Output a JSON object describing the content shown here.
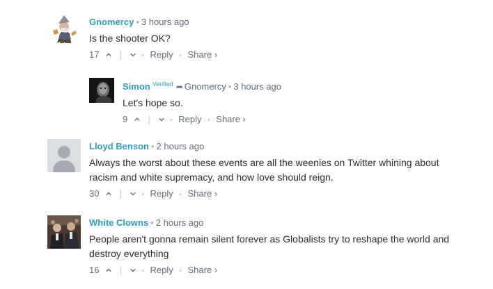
{
  "comments": [
    {
      "author": "Gnomercy",
      "sep": "•",
      "time": "3 hours ago",
      "text": "Is the shooter OK?",
      "votes": "17",
      "reply": "Reply",
      "share": "Share ›"
    },
    {
      "author": "Simon",
      "verified": "Verified",
      "parent": "Gnomercy",
      "sep": "•",
      "time": "3 hours ago",
      "text": "Let's hope so.",
      "votes": "9",
      "reply": "Reply",
      "share": "Share ›"
    },
    {
      "author": "Lloyd Benson",
      "sep": "•",
      "time": "2 hours ago",
      "text": "Always the worst about these events are all the weenies on Twitter whining about racism and white supremacy, and how love should reign.",
      "votes": "30",
      "reply": "Reply",
      "share": "Share ›"
    },
    {
      "author": "White Clowns",
      "sep": "•",
      "time": "2 hours ago",
      "text": "People aren't gonna remain silent forever as Globalists try to reshape the world and destroy everything",
      "votes": "16",
      "reply": "Reply",
      "share": "Share ›"
    }
  ],
  "icons": {
    "upvote": "chevron-up-icon",
    "downvote": "chevron-down-icon",
    "reply_to": "reply-arrow-icon"
  },
  "colors": {
    "author": "#2e9fc1",
    "meta": "#656c7a",
    "text": "#2a2e2e"
  }
}
